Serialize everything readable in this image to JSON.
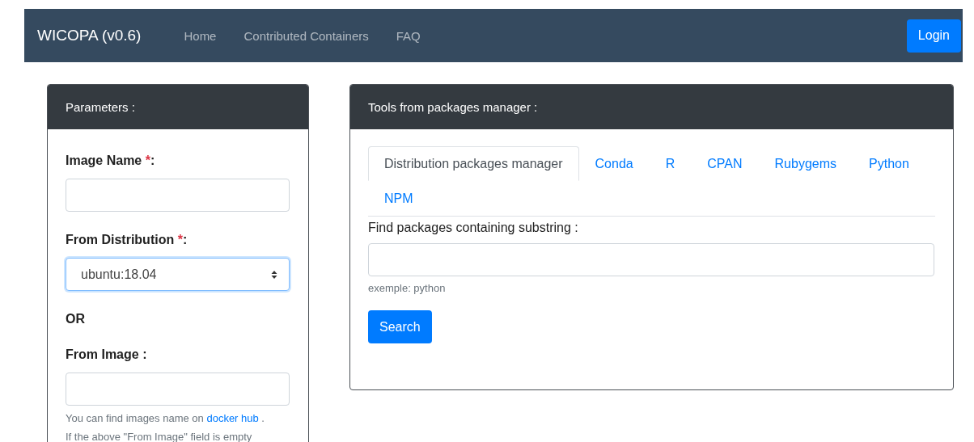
{
  "navbar": {
    "brand": "WICOPA (v0.6)",
    "links": [
      "Home",
      "Contributed Containers",
      "FAQ"
    ],
    "login": "Login"
  },
  "parameters": {
    "title": "Parameters :",
    "fields": [
      {
        "kind": "text",
        "label": "Image Name ",
        "required_mark": "*",
        "suffix": ":"
      },
      {
        "kind": "select",
        "label": "From Distribution ",
        "required_mark": "*",
        "suffix": ":",
        "value": "ubuntu:18.04",
        "focused": true
      },
      {
        "kind": "separator",
        "label": "OR"
      },
      {
        "kind": "text",
        "label": "From Image :"
      }
    ],
    "help": {
      "before": "You can find images name on ",
      "link": "docker hub",
      "after": " .",
      "line_2": "If the above \"From Image\" field is empty"
    }
  },
  "tools": {
    "title": "Tools from packages manager :",
    "tabs": [
      {
        "label": "Distribution packages manager",
        "selected": true
      },
      {
        "label": "Conda",
        "selected": false
      },
      {
        "label": "R",
        "selected": false
      },
      {
        "label": "CPAN",
        "selected": false
      },
      {
        "label": "Rubygems",
        "selected": false
      },
      {
        "label": "Python",
        "selected": false
      },
      {
        "label": "NPM",
        "selected": false
      }
    ],
    "search_label": "Find packages containing substring :",
    "hint": "exemple: python",
    "button": "Search"
  }
}
